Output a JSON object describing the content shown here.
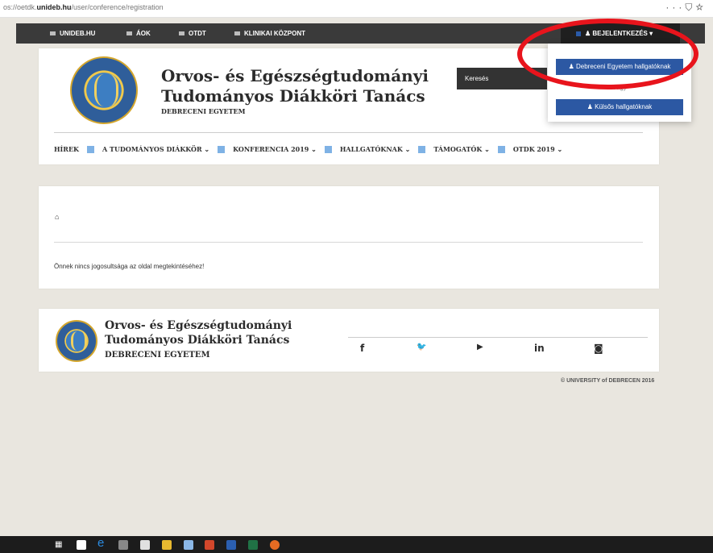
{
  "browser": {
    "url_prefix": "os://oetdk.",
    "url_domain": "unideb.hu",
    "url_path": "/user/conference/registration",
    "icons": [
      "more-icon",
      "shield-icon",
      "star-icon"
    ]
  },
  "topbar": {
    "links": [
      "UNIDEB.HU",
      "ÁOK",
      "OTDT",
      "KLINIKAI KÖZPONT"
    ],
    "login_label": "BEJELENTKEZÉS",
    "login_caret": "▾"
  },
  "login_menu": {
    "option1": "Debreceni Egyetem hallgatóknak",
    "separator": "Vagy",
    "option2": "Külsős hallgatóknak"
  },
  "header": {
    "title_line1": "Orvos- és Egészségtudományi",
    "title_line2": "Tudományos Diákköri Tanács",
    "subtitle": "DEBRECENI EGYETEM",
    "search_placeholder": "Keresés"
  },
  "nav": {
    "items": [
      {
        "label": "HÍREK"
      },
      {
        "label": "A TUDOMÁNYOS DIÁKKÖR ⌄"
      },
      {
        "label": "KONFERENCIA 2019 ⌄"
      },
      {
        "label": "HALLGATÓKNAK ⌄"
      },
      {
        "label": "TÁMOGATÓK ⌄"
      },
      {
        "label": "OTDK 2019 ⌄"
      }
    ]
  },
  "main": {
    "home_icon": "home-icon",
    "message": "Önnek nincs jogosultsága az oldal megtekintéséhez!"
  },
  "footer": {
    "title_line1": "Orvos- és Egészségtudományi",
    "title_line2": "Tudományos Diákköri Tanács",
    "subtitle": "DEBRECENI EGYETEM",
    "social": [
      "f",
      "🐦",
      "▶",
      "in",
      "◙"
    ],
    "copyright": "© UNIVERSITY of DEBRECEN 2016"
  },
  "colors": {
    "topbar": "#3a3a3a",
    "accent_blue": "#2c58a3",
    "nav_square": "#7fb2e5",
    "highlight_red": "#e8141c",
    "background": "#e9e6df"
  },
  "taskbar_icons": [
    "task-view-icon",
    "mail-icon",
    "edge-icon",
    "calculator-icon",
    "store-icon",
    "file-explorer-icon",
    "snip-icon",
    "powerpoint-icon",
    "word-icon",
    "excel-icon",
    "firefox-icon"
  ]
}
